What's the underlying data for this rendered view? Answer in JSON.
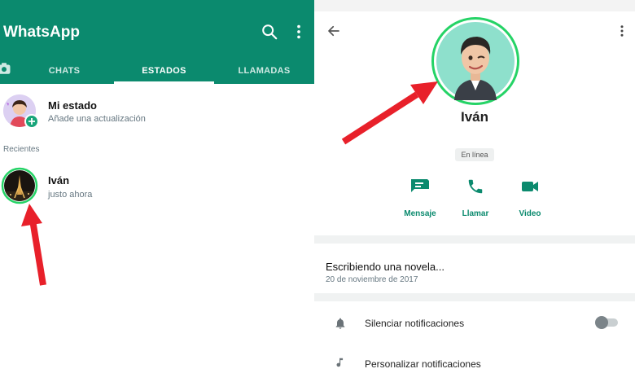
{
  "left": {
    "app_title": "WhatsApp",
    "tabs": [
      {
        "label": "CHATS"
      },
      {
        "label": "ESTADOS"
      },
      {
        "label": "LLAMADAS"
      }
    ],
    "my_status": {
      "title": "Mi estado",
      "subtitle": "Añade una actualización"
    },
    "recent_label": "Recientes",
    "recent_status": {
      "name": "Iván",
      "time": "justo ahora"
    }
  },
  "right": {
    "contact_name": "Iván",
    "presence": "En línea",
    "actions": [
      {
        "label": "Mensaje",
        "icon": "message-icon"
      },
      {
        "label": "Llamar",
        "icon": "phone-icon"
      },
      {
        "label": "Video",
        "icon": "video-icon"
      }
    ],
    "about": {
      "text": "Escribiendo una novela...",
      "date": "20 de noviembre de 2017"
    },
    "settings": [
      {
        "label": "Silenciar notificaciones",
        "icon": "bell-icon"
      },
      {
        "label": "Personalizar notificaciones",
        "icon": "music-note-icon"
      }
    ]
  },
  "colors": {
    "brand": "#0b8a6e",
    "annotation_arrow": "#e8202a"
  }
}
